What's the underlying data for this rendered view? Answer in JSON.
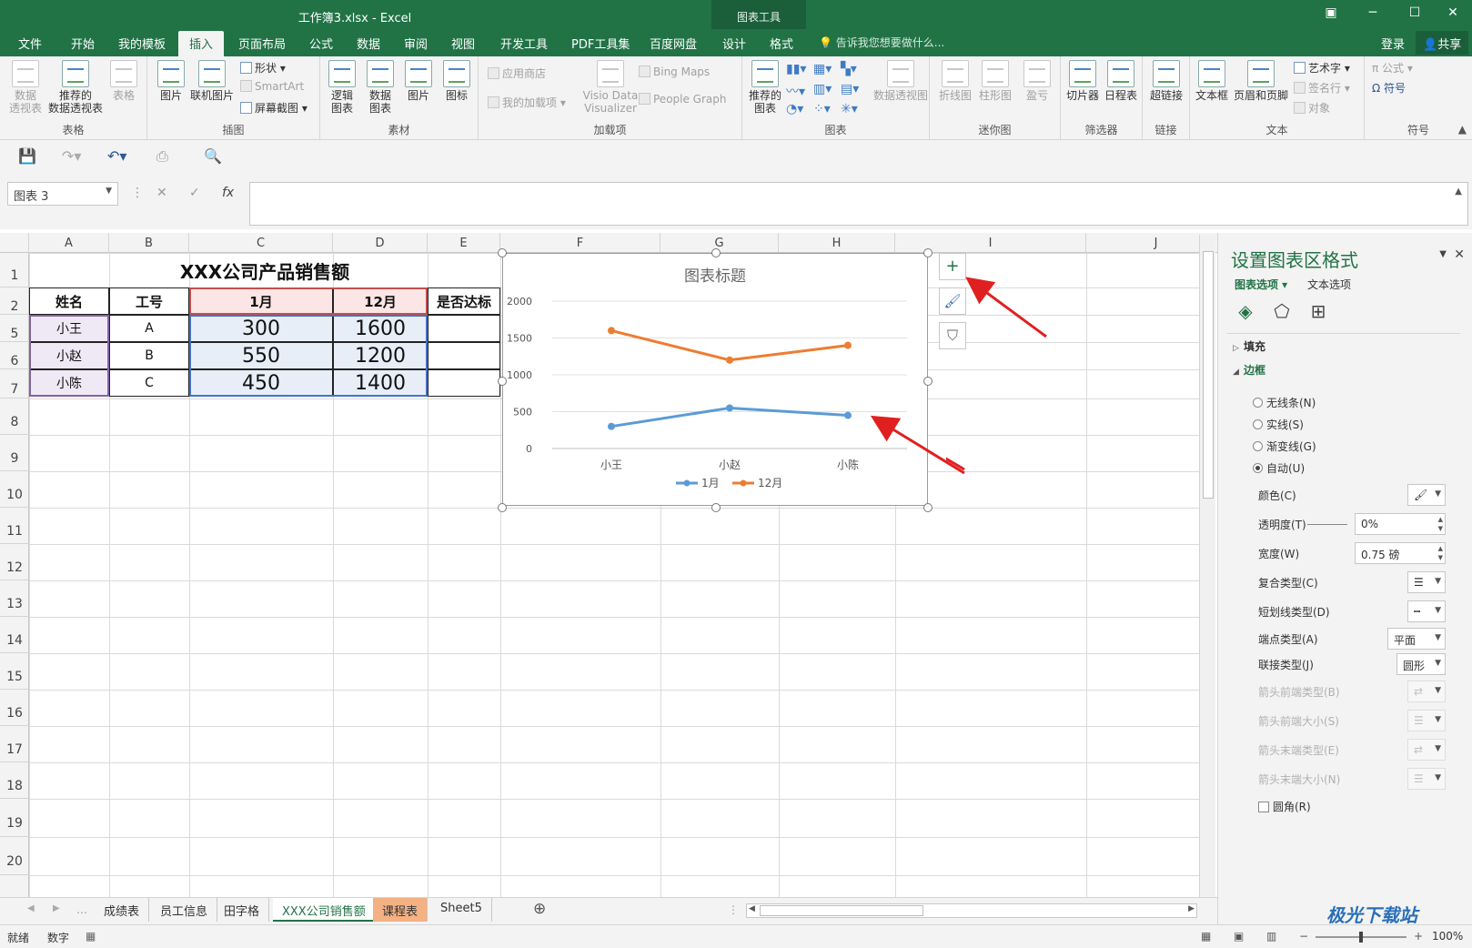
{
  "window": {
    "title": "工作簿3.xlsx - Excel",
    "context_tab_group": "图表工具",
    "controls": [
      "▣",
      "─",
      "☐",
      "✕"
    ]
  },
  "tabs": [
    "文件",
    "开始",
    "我的模板",
    "插入",
    "页面布局",
    "公式",
    "数据",
    "审阅",
    "视图",
    "开发工具",
    "PDF工具集",
    "百度网盘",
    "设计",
    "格式"
  ],
  "active_tab": "插入",
  "tell_me": "告诉我您想要做什么...",
  "login": "登录",
  "share": "共享",
  "ribbon": {
    "groups": {
      "table": {
        "label": "表格",
        "buttons": [
          "数据\n透视表",
          "推荐的\n数据透视表",
          "表格"
        ]
      },
      "illustrations": {
        "label": "插图",
        "buttons": [
          "图片",
          "联机图片"
        ],
        "small": [
          "形状 ▾",
          "SmartArt",
          "屏幕截图 ▾"
        ]
      },
      "materials": {
        "label": "素材",
        "buttons": [
          "逻辑\n图表",
          "数据\n图表",
          "图片",
          "图标"
        ]
      },
      "addins": {
        "label": "加载项",
        "small": [
          "应用商店",
          "我的加载项",
          "Bing Maps",
          "People Graph"
        ],
        "visio": "Visio Data\nVisualizer"
      },
      "charts": {
        "label": "图表",
        "buttons": [
          "推荐的\n图表",
          "数据透视图"
        ]
      },
      "sparklines": {
        "label": "迷你图",
        "buttons": [
          "折线图",
          "柱形图",
          "盈亏"
        ]
      },
      "filters": {
        "label": "筛选器",
        "buttons": [
          "切片器",
          "日程表"
        ]
      },
      "links": {
        "label": "链接",
        "buttons": [
          "超链接"
        ]
      },
      "text": {
        "label": "文本",
        "buttons": [
          "文本框",
          "页眉和页脚"
        ],
        "small": [
          "艺术字 ▾",
          "签名行 ▾",
          "对象"
        ]
      },
      "symbols": {
        "label": "符号",
        "small": [
          "π 公式 ▾",
          "Ω 符号"
        ]
      }
    }
  },
  "namebox": "图表 3",
  "columns": [
    "A",
    "B",
    "C",
    "D",
    "E",
    "F",
    "G",
    "H",
    "I",
    "J"
  ],
  "rows": [
    "1",
    "2",
    "5",
    "6",
    "7",
    "8",
    "9",
    "10",
    "11",
    "12",
    "13",
    "14",
    "15",
    "16",
    "17",
    "18",
    "19",
    "20"
  ],
  "table": {
    "title": "XXX公司产品销售额",
    "headers": [
      "姓名",
      "工号",
      "1月",
      "12月",
      "是否达标"
    ],
    "data": [
      [
        "小王",
        "A",
        "300",
        "1600",
        ""
      ],
      [
        "小赵",
        "B",
        "550",
        "1200",
        ""
      ],
      [
        "小陈",
        "C",
        "450",
        "1400",
        ""
      ]
    ]
  },
  "chart_data": {
    "type": "line",
    "title": "图表标题",
    "categories": [
      "小王",
      "小赵",
      "小陈"
    ],
    "series": [
      {
        "name": "1月",
        "values": [
          300,
          550,
          450
        ],
        "color": "#5b9bd5"
      },
      {
        "name": "12月",
        "values": [
          1600,
          1200,
          1400
        ],
        "color": "#ed7d31"
      }
    ],
    "yticks": [
      "0",
      "500",
      "1000",
      "1500",
      "2000"
    ],
    "ylim": [
      0,
      2000
    ],
    "grid": true,
    "legend": "bottom"
  },
  "chart_buttons": [
    "+",
    "🖌",
    "⛉"
  ],
  "pane": {
    "title": "设置图表区格式",
    "tabs": [
      "图表选项 ▾",
      "文本选项"
    ],
    "sections": {
      "fill": "填充",
      "border": "边框"
    },
    "radios": [
      "无线条(N)",
      "实线(S)",
      "渐变线(G)",
      "自动(U)"
    ],
    "selected_radio": 3,
    "props": [
      {
        "label": "颜色(C)",
        "value": ""
      },
      {
        "label": "透明度(T)",
        "value": "0%"
      },
      {
        "label": "宽度(W)",
        "value": "0.75 磅"
      },
      {
        "label": "复合类型(C)",
        "value": ""
      },
      {
        "label": "短划线类型(D)",
        "value": ""
      },
      {
        "label": "端点类型(A)",
        "value": "平面"
      },
      {
        "label": "联接类型(J)",
        "value": "圆形"
      },
      {
        "label": "箭头前端类型(B)",
        "value": ""
      },
      {
        "label": "箭头前端大小(S)",
        "value": ""
      },
      {
        "label": "箭头末端类型(E)",
        "value": ""
      },
      {
        "label": "箭头末端大小(N)",
        "value": ""
      }
    ],
    "rounded": "圆角(R)"
  },
  "sheet_tabs": [
    "成绩表",
    "员工信息",
    "田字格",
    "XXX公司销售额",
    "课程表",
    "Sheet5"
  ],
  "active_sheet": "XXX公司销售额",
  "status": {
    "ready": "就绪",
    "mode": "数字",
    "zoom": "100%"
  },
  "watermark": "极光下载站",
  "colors": {
    "excel_green": "#217346",
    "arrow_red": "#e02020"
  }
}
